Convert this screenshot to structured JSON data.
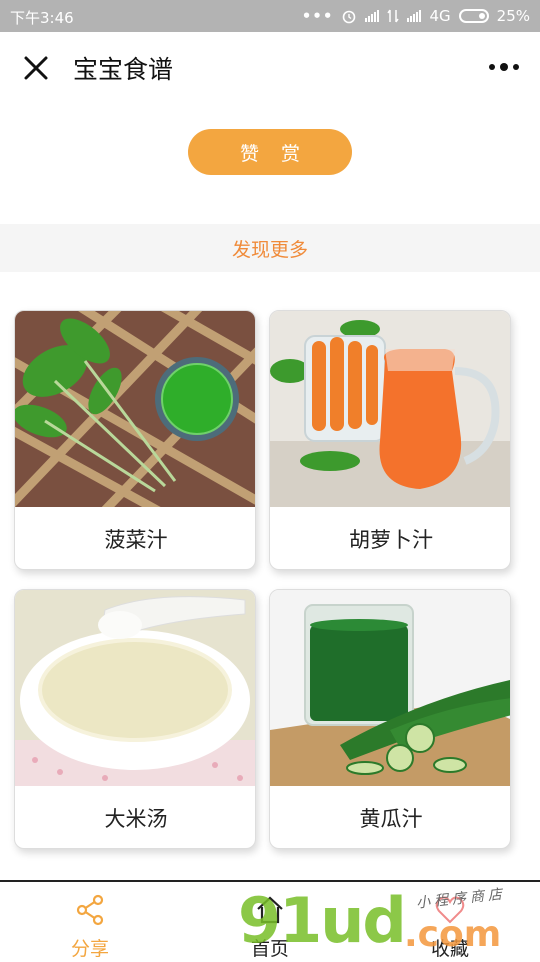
{
  "status_bar": {
    "time": "下午3:46",
    "network": "4G",
    "battery": "25%"
  },
  "navbar": {
    "title": "宝宝食谱"
  },
  "reward_button": "赞 赏",
  "discover_more": "发现更多",
  "recipes": [
    {
      "name": "菠菜汁"
    },
    {
      "name": "胡萝卜汁"
    },
    {
      "name": "大米汤"
    },
    {
      "name": "黄瓜汁"
    }
  ],
  "tabbar": {
    "share": "分享",
    "home": "首页",
    "favorite": "收藏"
  },
  "watermark": {
    "main": "91ud",
    "suffix": ".com",
    "tagline": "小程序商店"
  },
  "colors": {
    "accent": "#f3a640",
    "discover_text": "#f08b3a",
    "statusbar": "#b3b3b3"
  }
}
